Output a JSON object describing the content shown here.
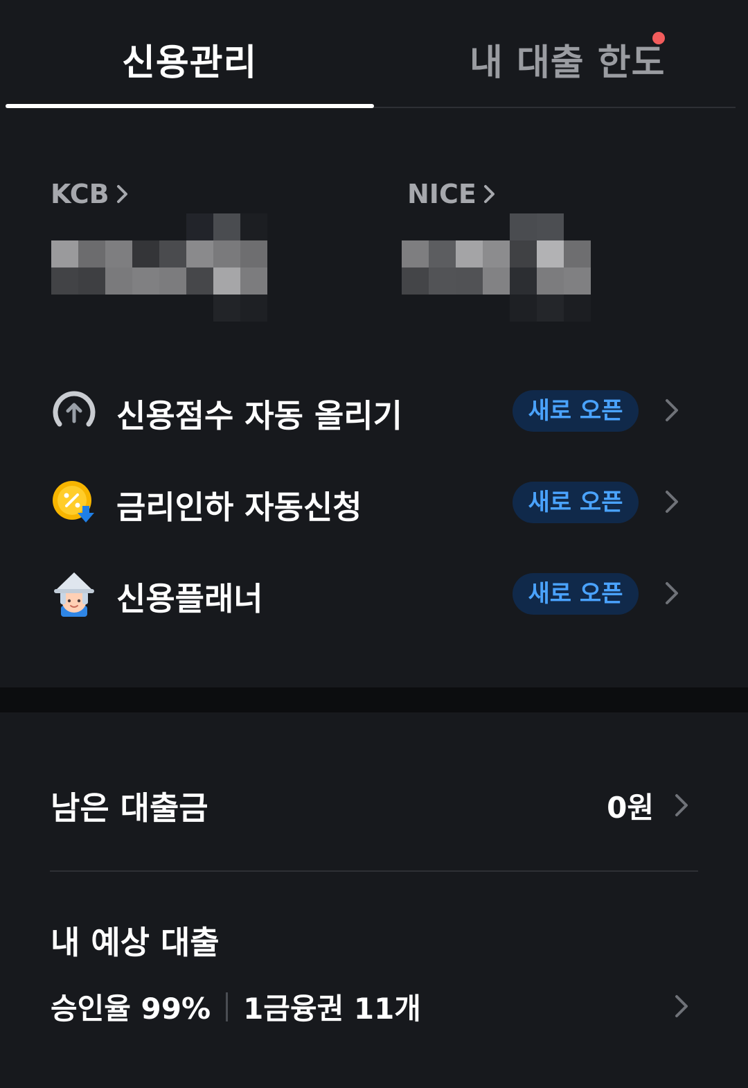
{
  "tabs": {
    "credit_management": "신용관리",
    "loan_limit": "내 대출 한도"
  },
  "bureaus": {
    "kcb_label": "KCB",
    "nice_label": "NICE"
  },
  "menu": {
    "items": [
      {
        "label": "신용점수 자동 올리기",
        "badge": "새로 오픈",
        "icon": "score-up-gauge-icon"
      },
      {
        "label": "금리인하 자동신청",
        "badge": "새로 오픈",
        "icon": "rate-down-coin-icon"
      },
      {
        "label": "신용플래너",
        "badge": "새로 오픈",
        "icon": "planner-character-icon"
      }
    ]
  },
  "remaining_loan": {
    "label": "남은 대출금",
    "value": "0원"
  },
  "expected_loan": {
    "title": "내 예상 대출",
    "approval": "승인율 99%",
    "institutions": "1금융권 11개"
  },
  "colors": {
    "background": "#17191d",
    "badge_bg": "#10294a",
    "badge_text": "#4aa3ff",
    "notification_dot": "#f25c5c"
  }
}
